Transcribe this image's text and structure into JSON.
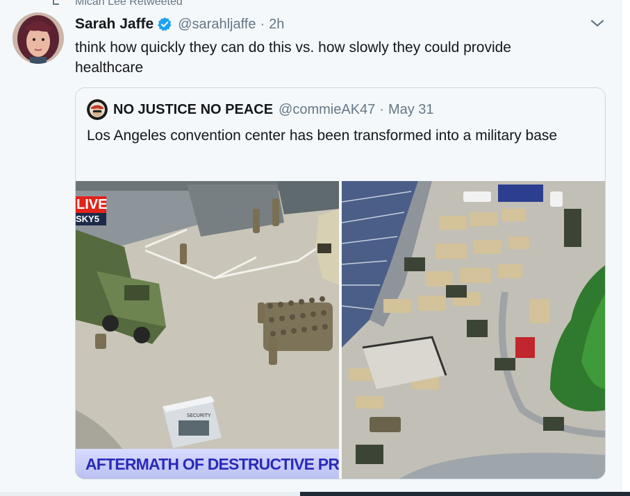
{
  "retweet": {
    "text": "Micah Lee Retweeted"
  },
  "tweet": {
    "author_name": "Sarah Jaffe",
    "handle": "@sarahljaffe",
    "separator": "·",
    "time": "2h",
    "text": "think how quickly they can do this vs. how slowly they could provide healthcare"
  },
  "quote": {
    "author_name": "NO JUSTICE NO PEACE",
    "handle": "@commieAK47",
    "separator": "·",
    "time": "May 31",
    "text": "Los Angeles convention center has been transformed into a military base",
    "media": {
      "live_label": "LIVE",
      "station_label": "SKY5",
      "chyron": "AFTERMATH OF DESTRUCTIVE PRO",
      "security_sign": "SECURITY"
    }
  },
  "icons": {
    "retweet": "retweet-icon",
    "verified": "verified-badge-icon",
    "menu": "chevron-down-icon"
  },
  "colors": {
    "background": "#f5f8fa",
    "text": "#14171a",
    "secondary": "#657786",
    "verified": "#1da1f2",
    "border": "#ccd6dd"
  }
}
